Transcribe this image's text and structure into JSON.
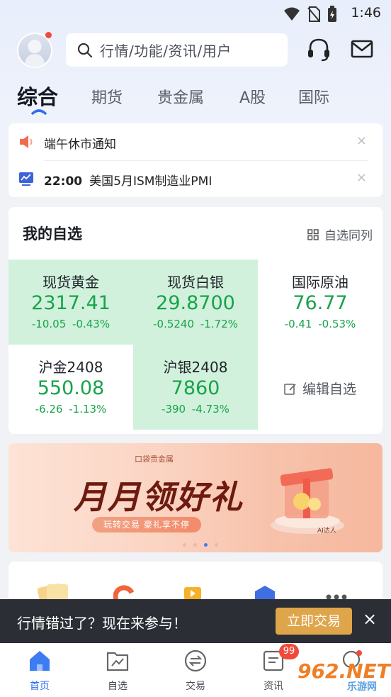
{
  "status_bar": {
    "time": "1:46"
  },
  "header": {
    "search_placeholder": "行情/功能/资讯/用户"
  },
  "tabs": [
    {
      "label": "综合",
      "active": true
    },
    {
      "label": "期货"
    },
    {
      "label": "贵金属"
    },
    {
      "label": "A股"
    },
    {
      "label": "国际"
    }
  ],
  "notices": [
    {
      "icon": "speaker-icon",
      "time": "",
      "text": "端午休市通知",
      "close": "×"
    },
    {
      "icon": "chart-trend-icon",
      "time": "22:00",
      "text": "美国5月ISM制造业PMI",
      "close": "×"
    }
  ],
  "watchlist": {
    "title": "我的自选",
    "sync_label": "自选同列",
    "edit_label": "编辑自选",
    "items": [
      {
        "name": "现货黄金",
        "price": "2317.41",
        "change": "-10.05",
        "pct": "-0.43%",
        "highlight": true
      },
      {
        "name": "现货白银",
        "price": "29.8700",
        "change": "-0.5240",
        "pct": "-1.72%",
        "highlight": true
      },
      {
        "name": "国际原油",
        "price": "76.77",
        "change": "-0.41",
        "pct": "-0.53%",
        "highlight": false
      },
      {
        "name": "沪金2408",
        "price": "550.08",
        "change": "-6.26",
        "pct": "-1.13%",
        "highlight": false
      },
      {
        "name": "沪银2408",
        "price": "7860",
        "change": "-390",
        "pct": "-4.73%",
        "highlight": true
      }
    ],
    "colors": {
      "down": "#17a34a",
      "highlight_bg": "#d1f1dc"
    }
  },
  "banner": {
    "brand": "口袋贵金属",
    "headline": "月月领好礼",
    "subtitle": "玩转交易 豪礼享不停",
    "tag": "AI达人",
    "dots": 4,
    "active_dot": 2
  },
  "toast": {
    "text": "行情错过了？现在来参与！",
    "button": "立即交易",
    "close": "×"
  },
  "bottom_nav": [
    {
      "label": "首页",
      "icon": "home-icon",
      "active": true
    },
    {
      "label": "自选",
      "icon": "watchlist-icon"
    },
    {
      "label": "交易",
      "icon": "trade-icon"
    },
    {
      "label": "资讯",
      "icon": "news-icon",
      "badge": "99"
    },
    {
      "label": "",
      "icon": "profile-icon"
    }
  ],
  "watermark": {
    "text": "962.NET",
    "sub": "乐游网"
  }
}
